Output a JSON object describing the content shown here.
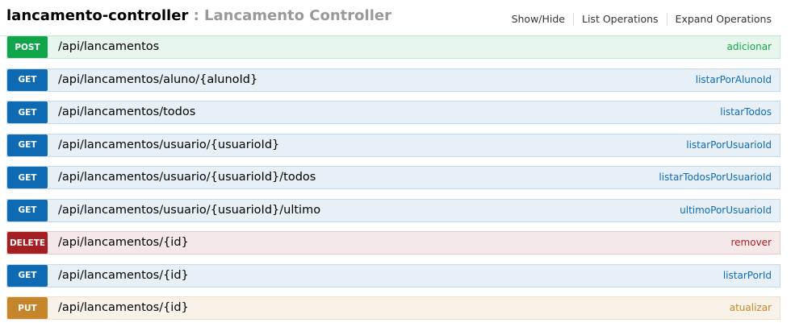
{
  "resource": {
    "name": "lancamento-controller",
    "separator": " : ",
    "description": "Lancamento Controller"
  },
  "links": {
    "show_hide": "Show/Hide",
    "list_operations": "List Operations",
    "expand_operations": "Expand Operations"
  },
  "operations": [
    {
      "method": "POST",
      "path": "/api/lancamentos",
      "name": "adicionar"
    },
    {
      "method": "GET",
      "path": "/api/lancamentos/aluno/{alunoId}",
      "name": "listarPorAlunoId"
    },
    {
      "method": "GET",
      "path": "/api/lancamentos/todos",
      "name": "listarTodos"
    },
    {
      "method": "GET",
      "path": "/api/lancamentos/usuario/{usuarioId}",
      "name": "listarPorUsuarioId"
    },
    {
      "method": "GET",
      "path": "/api/lancamentos/usuario/{usuarioId}/todos",
      "name": "listarTodosPorUsuarioId"
    },
    {
      "method": "GET",
      "path": "/api/lancamentos/usuario/{usuarioId}/ultimo",
      "name": "ultimoPorUsuarioId"
    },
    {
      "method": "DELETE",
      "path": "/api/lancamentos/{id}",
      "name": "remover"
    },
    {
      "method": "GET",
      "path": "/api/lancamentos/{id}",
      "name": "listarPorId"
    },
    {
      "method": "PUT",
      "path": "/api/lancamentos/{id}",
      "name": "atualizar"
    }
  ],
  "colors": {
    "post": "#10a54a",
    "get": "#0f6ab4",
    "delete": "#a41e22",
    "put": "#c5862b"
  }
}
